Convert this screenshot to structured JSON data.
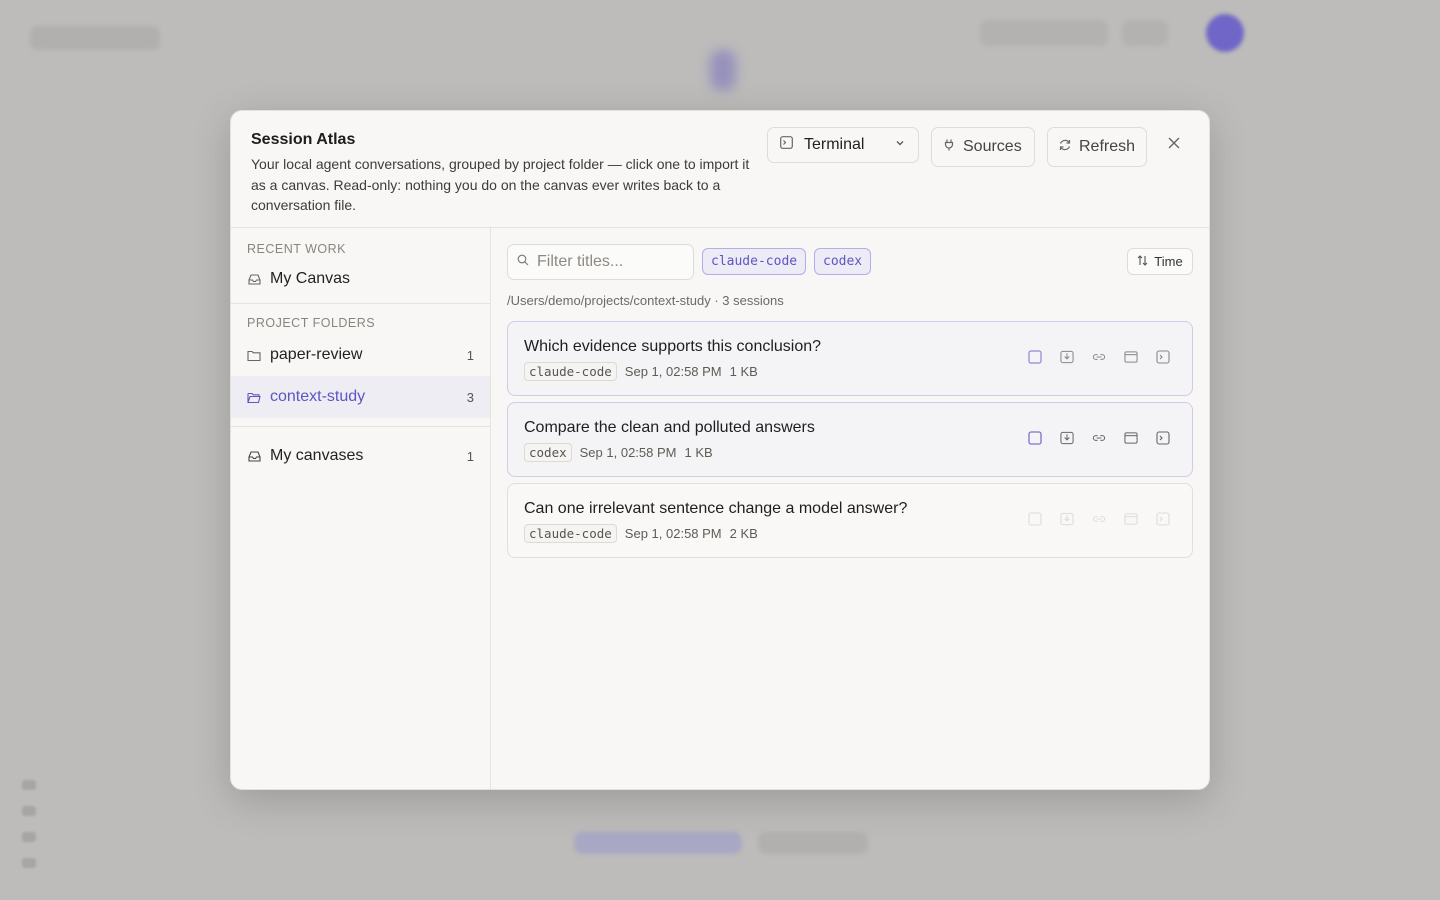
{
  "modal": {
    "title": "Session Atlas",
    "description": "Your local agent conversations, grouped by project folder — click one to import it as a canvas. Read-only: nothing you do on the canvas ever writes back to a conversation file.",
    "terminal_select": {
      "value": "Terminal",
      "icon": "terminal-icon"
    },
    "sources_label": "Sources",
    "refresh_label": "Refresh"
  },
  "sidebar": {
    "recent_label": "RECENT WORK",
    "recent_items": [
      {
        "label": "My Canvas",
        "icon": "inbox-icon"
      }
    ],
    "folders_label": "PROJECT FOLDERS",
    "folders": [
      {
        "label": "paper-review",
        "count": "1",
        "icon": "folder-icon"
      },
      {
        "label": "context-study",
        "count": "3",
        "icon": "folder-open-icon",
        "active": true
      }
    ],
    "canvases": {
      "label": "My canvases",
      "count": "1",
      "icon": "inbox-icon"
    }
  },
  "main": {
    "filter_placeholder": "Filter titles...",
    "chips": [
      "claude-code",
      "codex"
    ],
    "sort_label": "Time",
    "path": "/Users/demo/projects/context-study · 3 sessions",
    "sessions": [
      {
        "title": "Which evidence supports this conclusion?",
        "source": "claude-code",
        "time": "Sep 1, 02:58 PM",
        "size": "1 KB"
      },
      {
        "title": "Compare the clean and polluted answers",
        "source": "codex",
        "time": "Sep 1, 02:58 PM",
        "size": "1 KB"
      },
      {
        "title": "Can one irrelevant sentence change a model answer?",
        "source": "claude-code",
        "time": "Sep 1, 02:58 PM",
        "size": "2 KB"
      }
    ]
  },
  "colors": {
    "accent": "#5e55c4",
    "chip_bg": "#ecebf6",
    "modal_bg": "#f8f7f5"
  }
}
